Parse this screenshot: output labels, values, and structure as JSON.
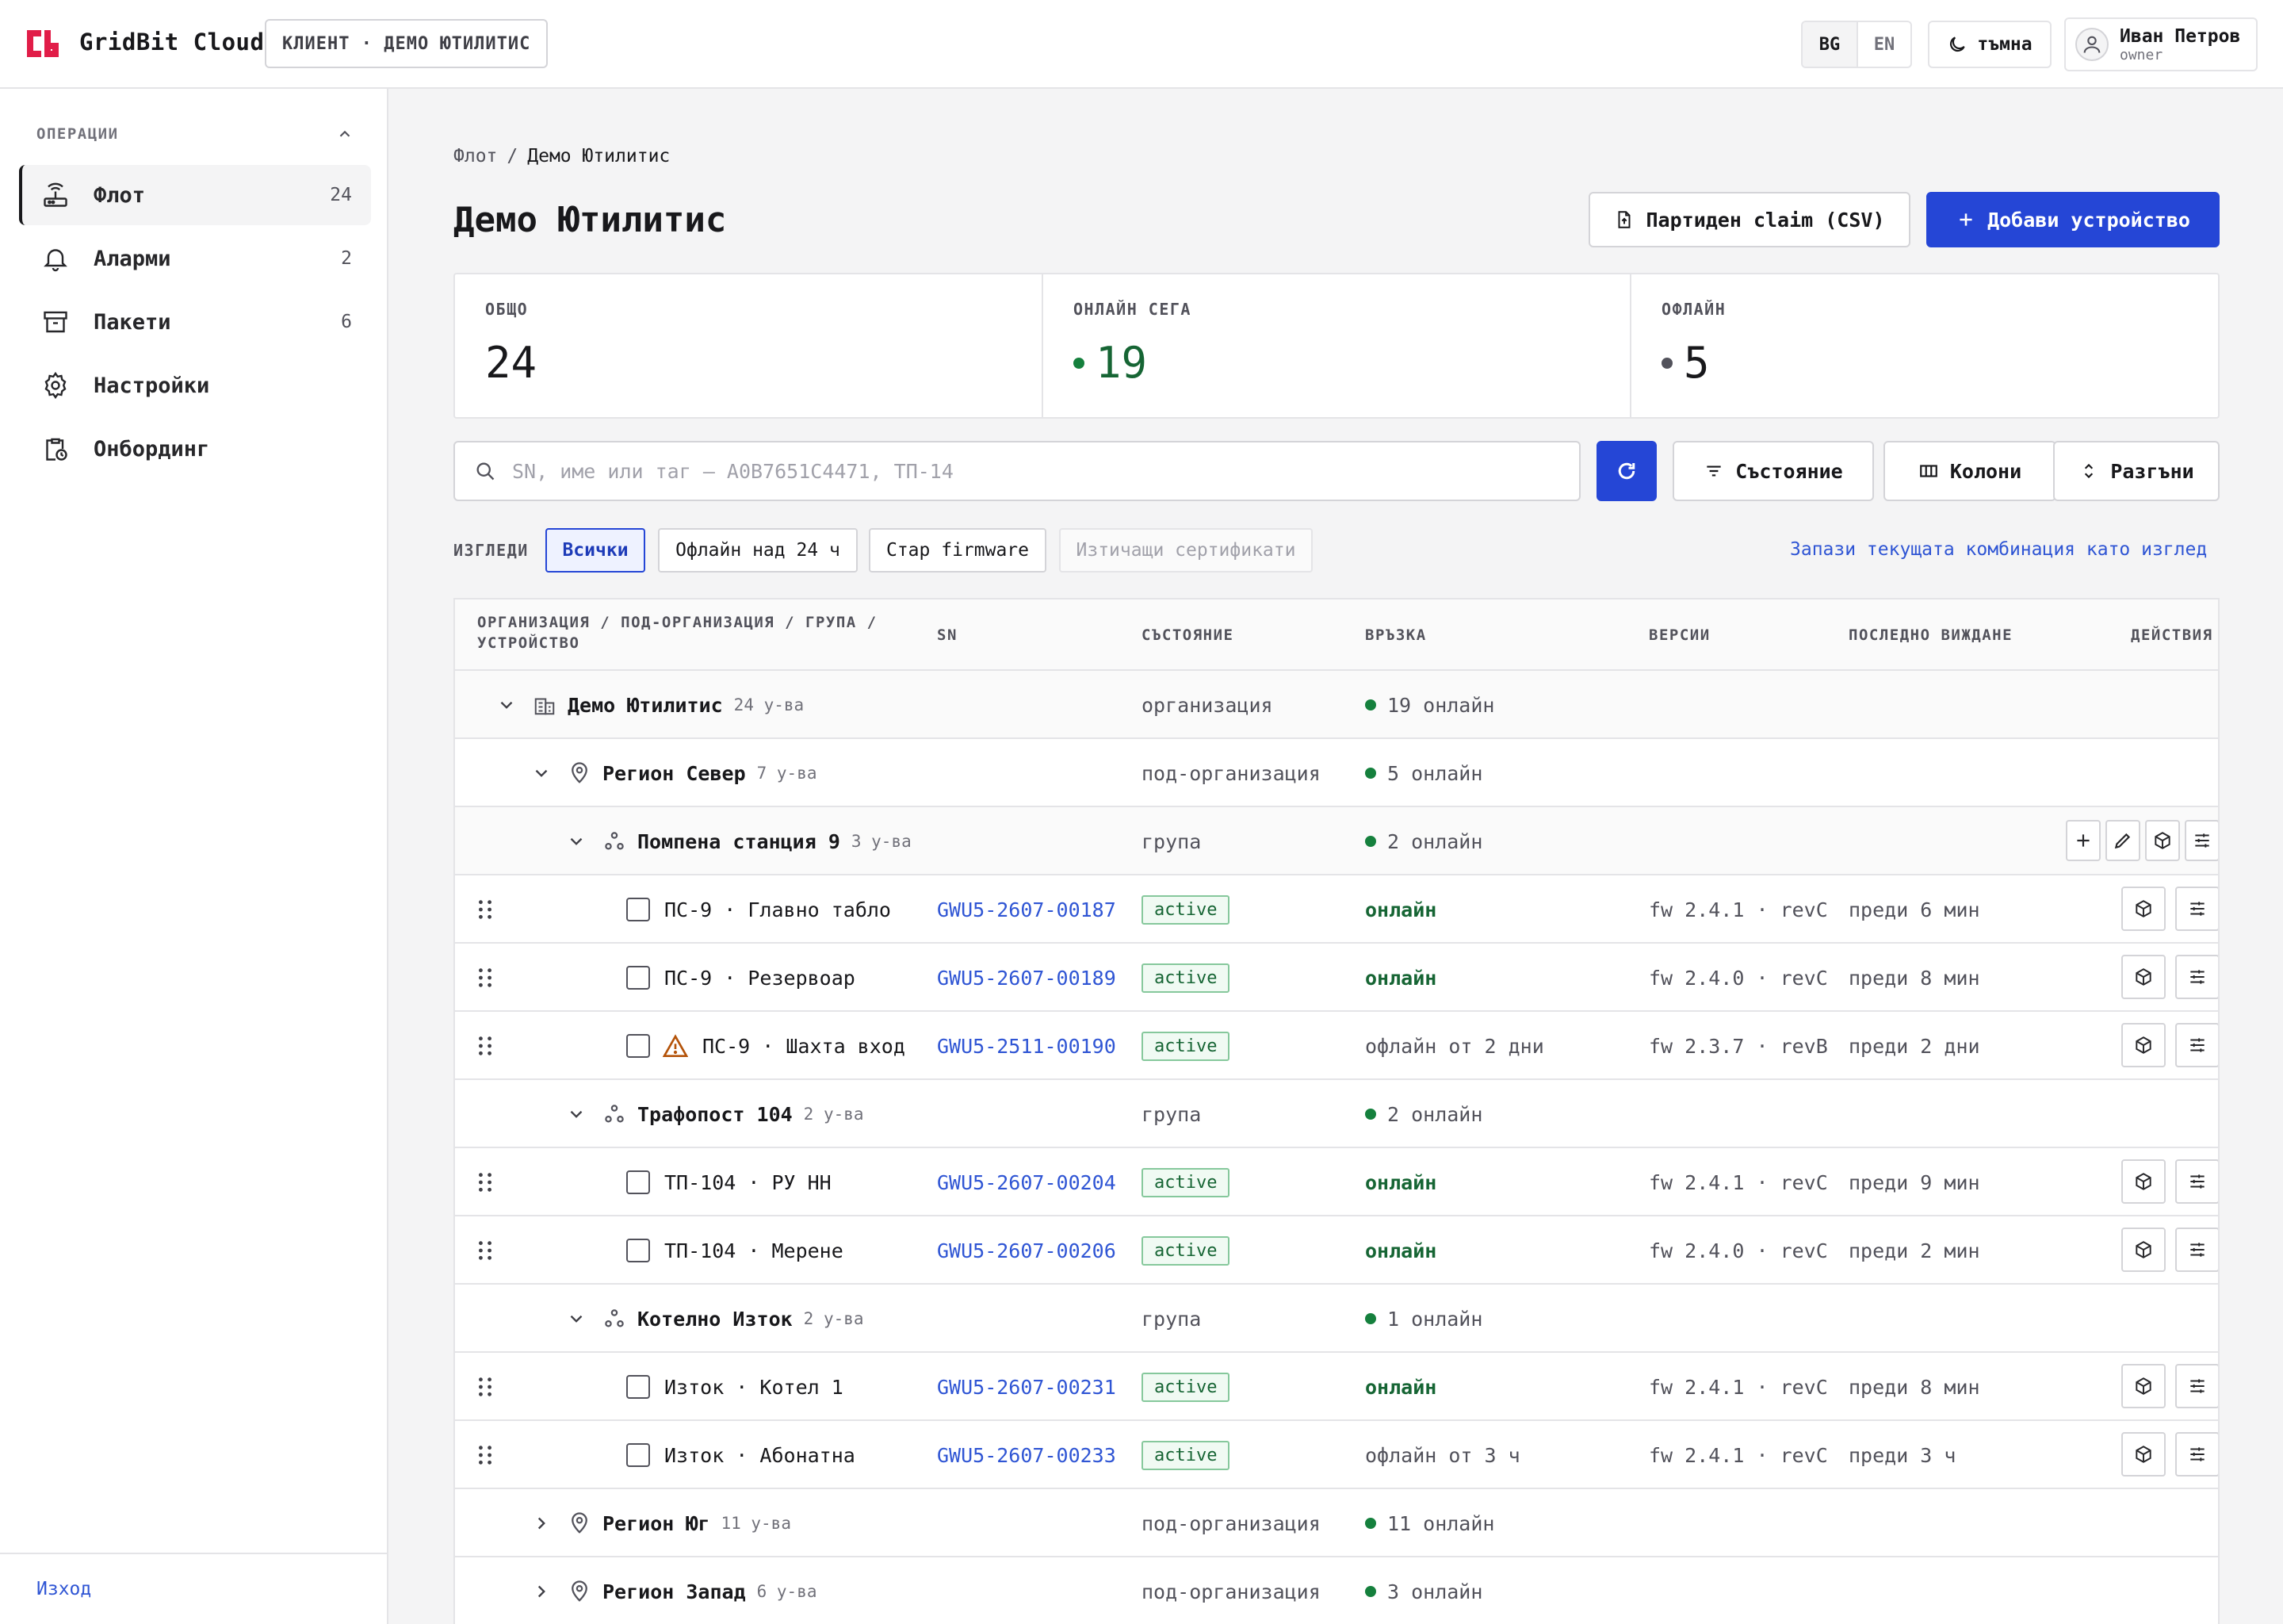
{
  "app": {
    "brand": "GridBit Cloud",
    "client_chip": "КЛИЕНТ · ДЕМО ЮТИЛИТИС",
    "lang": [
      "BG",
      "EN"
    ],
    "theme_label": "тъмна",
    "user_name": "Иван Петров",
    "user_role": "owner",
    "accent": "#2546d6",
    "logo_color": "#e11d48"
  },
  "sidebar": {
    "section": "ОПЕРАЦИИ",
    "items": [
      {
        "label": "Флот",
        "count": "24",
        "icon": "router-icon"
      },
      {
        "label": "Аларми",
        "count": "2",
        "icon": "bell-icon"
      },
      {
        "label": "Пакети",
        "count": "6",
        "icon": "archive-icon"
      },
      {
        "label": "Настройки",
        "count": "",
        "icon": "gear-icon"
      },
      {
        "label": "Онбординг",
        "count": "",
        "icon": "clipboard-clock-icon"
      }
    ],
    "logout": "Изход"
  },
  "breadcrumb": {
    "root": "Флот",
    "sep": "/",
    "current": "Демо Ютилитис"
  },
  "page": {
    "title": "Демо Ютилитис",
    "bulk_claim": "Партиден claim (CSV)",
    "add_device": "Добави устройство"
  },
  "stats": [
    {
      "label": "ОБЩО",
      "value": "24"
    },
    {
      "label": "ОНЛАЙН СЕГА",
      "value": "19"
    },
    {
      "label": "ОФЛАЙН",
      "value": "5"
    }
  ],
  "toolbar": {
    "search_placeholder": "SN, име или таг — A0B7651C4471, ТП-14",
    "state": "Състояние",
    "columns": "Колони",
    "expand": "Разгъни"
  },
  "views": {
    "label": "ИЗГЛЕДИ",
    "chips": [
      "Всички",
      "Офлайн над 24 ч",
      "Стар firmware",
      "Изтичащи сертификати"
    ],
    "save": "Запази текущата комбинация като изглед"
  },
  "table": {
    "headers": {
      "name_1": "ОРГАНИЗАЦИЯ / ПОД-ОРГАНИЗАЦИЯ / ГРУПА /",
      "name_2": "УСТРОЙСТВО",
      "sn": "SN",
      "state": "СЪСТОЯНИЕ",
      "link": "ВРЪЗКА",
      "versions": "ВЕРСИИ",
      "seen": "ПОСЛЕДНО ВИЖДАНЕ",
      "actions": "ДЕЙСТВИЯ"
    },
    "rows": [
      {
        "kind": "org",
        "level": 0,
        "expanded": true,
        "name": "Демо Ютилитис",
        "count": "24 у-ва",
        "state": "организация",
        "link": "19 онлайн"
      },
      {
        "kind": "suborg",
        "level": 1,
        "expanded": true,
        "name": "Регион Север",
        "count": "7 у-ва",
        "state": "под-организация",
        "link": "5 онлайн"
      },
      {
        "kind": "group",
        "level": 2,
        "expanded": true,
        "name": "Помпена станция 9",
        "count": "3 у-ва",
        "state": "група",
        "link": "2 онлайн",
        "actions": true
      },
      {
        "kind": "device",
        "name": "ПС-9 · Главно табло",
        "warn": false,
        "sn": "GWU5-2607-00187",
        "state": "active",
        "link": "онлайн",
        "online": true,
        "versions": "fw 2.4.1 · revC",
        "seen": "преди 6 мин"
      },
      {
        "kind": "device",
        "name": "ПС-9 · Резервоар",
        "warn": false,
        "sn": "GWU5-2607-00189",
        "state": "active",
        "link": "онлайн",
        "online": true,
        "versions": "fw 2.4.0 · revC",
        "seen": "преди 8 мин"
      },
      {
        "kind": "device",
        "name": "ПС-9 · Шахта вход",
        "warn": true,
        "sn": "GWU5-2511-00190",
        "state": "active",
        "link": "офлайн от 2 дни",
        "online": false,
        "versions": "fw 2.3.7 · revB",
        "seen": "преди 2 дни"
      },
      {
        "kind": "group",
        "level": 2,
        "expanded": true,
        "name": "Трафопост 104",
        "count": "2 у-ва",
        "state": "група",
        "link": "2 онлайн"
      },
      {
        "kind": "device",
        "name": "ТП-104 · РУ НН",
        "warn": false,
        "sn": "GWU5-2607-00204",
        "state": "active",
        "link": "онлайн",
        "online": true,
        "versions": "fw 2.4.1 · revC",
        "seen": "преди 9 мин"
      },
      {
        "kind": "device",
        "name": "ТП-104 · Мерене",
        "warn": false,
        "sn": "GWU5-2607-00206",
        "state": "active",
        "link": "онлайн",
        "online": true,
        "versions": "fw 2.4.0 · revC",
        "seen": "преди 2 мин"
      },
      {
        "kind": "group",
        "level": 2,
        "expanded": true,
        "name": "Котелно Изток",
        "count": "2 у-ва",
        "state": "група",
        "link": "1 онлайн"
      },
      {
        "kind": "device",
        "name": "Изток · Котел 1",
        "warn": false,
        "sn": "GWU5-2607-00231",
        "state": "active",
        "link": "онлайн",
        "online": true,
        "versions": "fw 2.4.1 · revC",
        "seen": "преди 8 мин"
      },
      {
        "kind": "device",
        "name": "Изток · Абонатна",
        "warn": false,
        "sn": "GWU5-2607-00233",
        "state": "active",
        "link": "офлайн от 3 ч",
        "online": false,
        "versions": "fw 2.4.1 · revC",
        "seen": "преди 3 ч"
      },
      {
        "kind": "suborg",
        "level": 1,
        "expanded": false,
        "name": "Регион Юг",
        "count": "11 у-ва",
        "state": "под-организация",
        "link": "11 онлайн"
      },
      {
        "kind": "suborg",
        "level": 1,
        "expanded": false,
        "name": "Регион Запад",
        "count": "6 у-ва",
        "state": "под-организация",
        "link": "3 онлайн"
      }
    ]
  }
}
